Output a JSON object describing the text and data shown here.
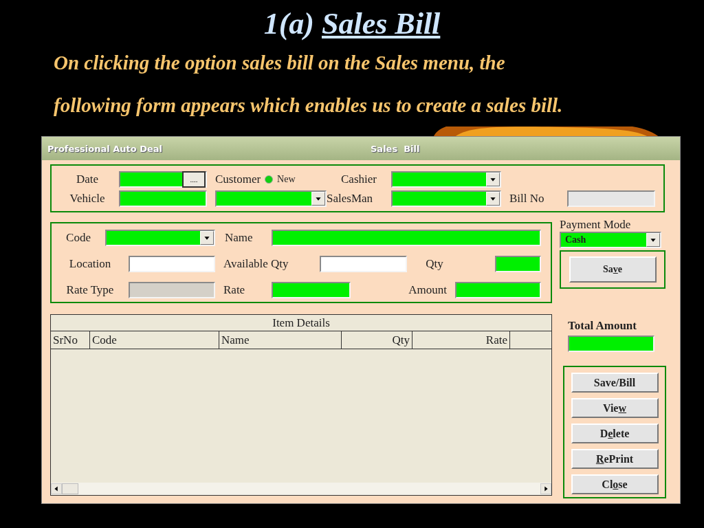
{
  "slide": {
    "title_number": "1(a)",
    "title_text": "Sales Bill",
    "intro": [
      "On clicking the option sales bill on the Sales menu, the",
      "following form appears which enables us to create a sales bill."
    ]
  },
  "window": {
    "app_title": "Professional Auto Deal",
    "form_title": "Sales  Bill"
  },
  "header": {
    "date_label": "Date",
    "date_button": "....",
    "customer_label": "Customer",
    "new_option": {
      "label": "New",
      "selected": true
    },
    "cashier_label": "Cashier",
    "vehicle_label": "Vehicle",
    "salesman_label": "SalesMan",
    "bill_no_label": "Bill No"
  },
  "item_entry": {
    "code_label": "Code",
    "name_label": "Name",
    "location_label": "Location",
    "available_qty_label": "Available Qty",
    "qty_label": "Qty",
    "rate_type_label": "Rate Type",
    "rate_label": "Rate",
    "amount_label": "Amount"
  },
  "payment": {
    "label": "Payment Mode",
    "value": "Cash"
  },
  "save_button": {
    "pre": "Sa",
    "key": "v",
    "post": "e"
  },
  "total": {
    "label": "Total Amount"
  },
  "grid": {
    "caption": "Item Details",
    "columns": [
      {
        "label": "SrNo",
        "kind": "text"
      },
      {
        "label": "Code",
        "kind": "text"
      },
      {
        "label": "Name",
        "kind": "text"
      },
      {
        "label": "Qty",
        "kind": "number"
      },
      {
        "label": "Rate",
        "kind": "number"
      }
    ]
  },
  "actions": [
    {
      "pre": "Save/Bill"
    },
    {
      "pre": "Vie",
      "key": "w"
    },
    {
      "pre": "D",
      "key": "e",
      "post": "lete"
    },
    {
      "key": "R",
      "post": "ePrint"
    },
    {
      "pre": "Cl",
      "key": "o",
      "post": "se"
    }
  ]
}
